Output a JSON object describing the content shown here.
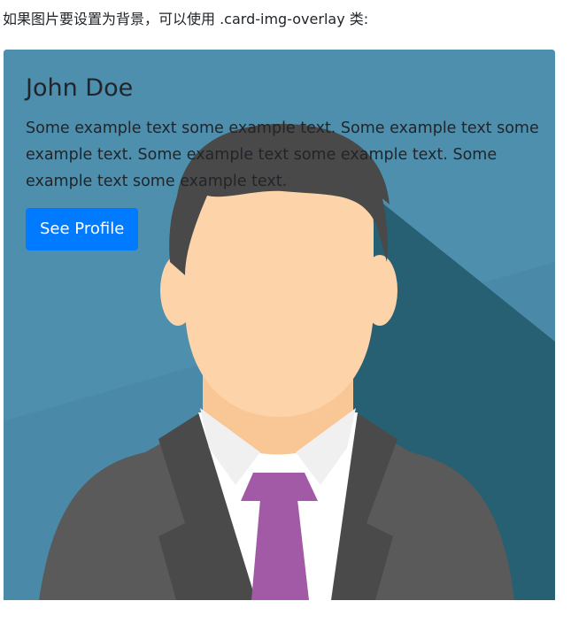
{
  "intro_text": "如果图片要设置为背景，可以使用 .card-img-overlay 类:",
  "card": {
    "title": "John Doe",
    "text": "Some example text some example text. Some example text some example text. Some example text some example text. Some example text some example text.",
    "button_label": "See Profile"
  },
  "colors": {
    "background": "#4a8aa8",
    "shadow": "#275f73",
    "hair": "#494949",
    "skin": "#fdd3a9",
    "suit": "#5a5a5a",
    "shirt": "#ffffff",
    "tie": "#a25aa6",
    "button": "#007bff",
    "text": "#212529"
  },
  "icons": {
    "card_image": "avatar-man-in-suit-illustration"
  }
}
